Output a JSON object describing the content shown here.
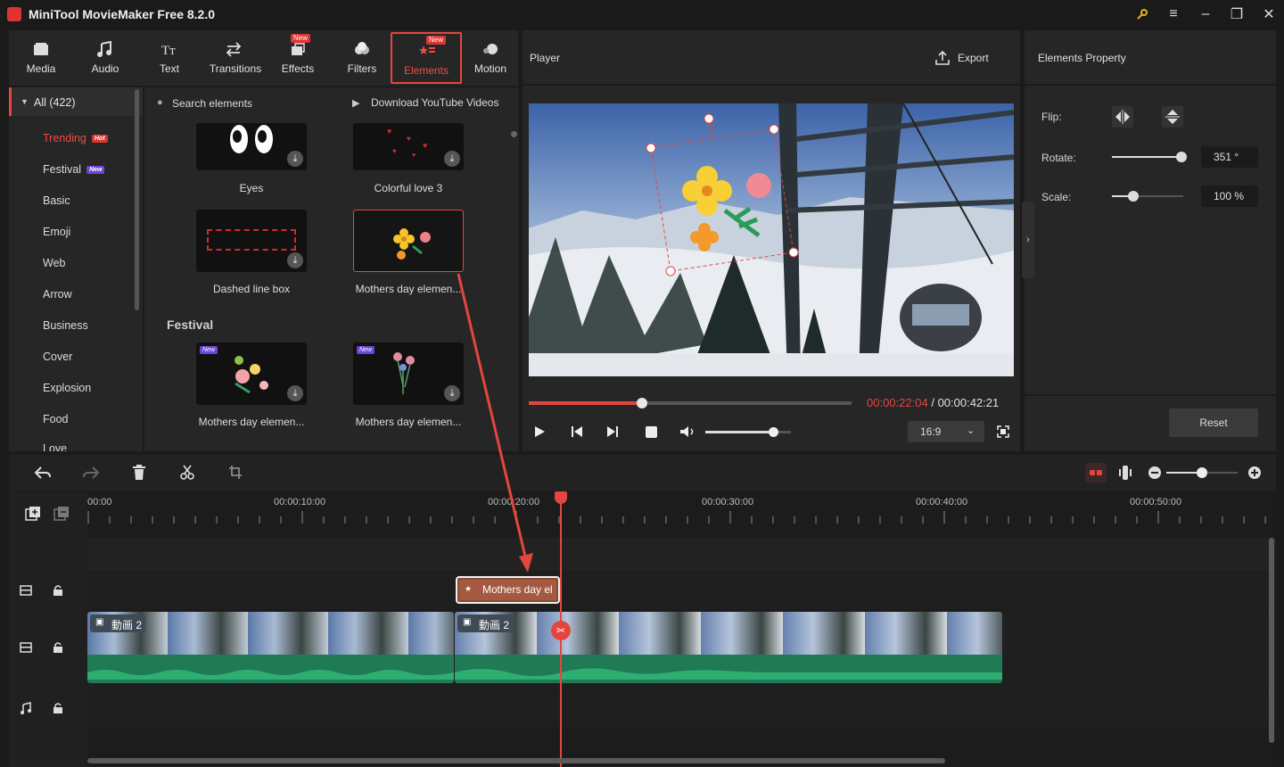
{
  "app": {
    "title": "MiniTool MovieMaker Free 8.2.0"
  },
  "toolbar": {
    "tabs": [
      {
        "label": "Media",
        "icon": "media-icon"
      },
      {
        "label": "Audio",
        "icon": "music-note-icon"
      },
      {
        "label": "Text",
        "icon": "text-icon"
      },
      {
        "label": "Transitions",
        "icon": "transitions-icon"
      },
      {
        "label": "Effects",
        "icon": "effects-icon",
        "badge": "New"
      },
      {
        "label": "Filters",
        "icon": "filters-icon"
      },
      {
        "label": "Elements",
        "icon": "elements-icon",
        "badge": "New",
        "active": true
      },
      {
        "label": "Motion",
        "icon": "motion-icon"
      }
    ]
  },
  "categories": {
    "all_label": "All (422)",
    "items": [
      {
        "label": "Trending",
        "badge": "Hot",
        "active": true
      },
      {
        "label": "Festival",
        "badge": "New"
      },
      {
        "label": "Basic"
      },
      {
        "label": "Emoji"
      },
      {
        "label": "Web"
      },
      {
        "label": "Arrow"
      },
      {
        "label": "Business"
      },
      {
        "label": "Cover"
      },
      {
        "label": "Explosion"
      },
      {
        "label": "Food"
      },
      {
        "label": "Love"
      }
    ]
  },
  "elements": {
    "search_placeholder": "Search elements",
    "download_link": "Download YouTube Videos",
    "section_festival": "Festival",
    "items": [
      {
        "label": "Eyes"
      },
      {
        "label": "Colorful love 3"
      },
      {
        "label": "Dashed line box"
      },
      {
        "label": "Mothers day elemen...",
        "selected": true
      },
      {
        "label": "Mothers day elemen...",
        "badge": "New"
      },
      {
        "label": "Mothers day elemen...",
        "badge": "New"
      }
    ]
  },
  "player": {
    "title": "Player",
    "export_label": "Export",
    "time_current": "00:00:22:04",
    "time_separator": "/",
    "time_total": "00:00:42:21",
    "aspect_ratio": "16:9",
    "progress": 0.35,
    "volume": 0.8
  },
  "properties": {
    "title": "Elements Property",
    "flip_label": "Flip:",
    "rotate_label": "Rotate:",
    "rotate_value": "351 °",
    "rotate_level": 0.97,
    "scale_label": "Scale:",
    "scale_value": "100 %",
    "scale_level": 0.3,
    "reset_label": "Reset"
  },
  "timeline": {
    "ruler": [
      "00:00",
      "00:00:10:00",
      "00:00:20:00",
      "00:00:30:00",
      "00:00:40:00",
      "00:00:50:00"
    ],
    "element_clip_label": "Mothers day el",
    "video_clip_1_label": "動画 2",
    "video_clip_2_label": "動画 2",
    "zoom_level": 0.5
  },
  "colors": {
    "accent": "#e4463f",
    "panel": "#262626",
    "audio_wave": "#2fae72"
  }
}
